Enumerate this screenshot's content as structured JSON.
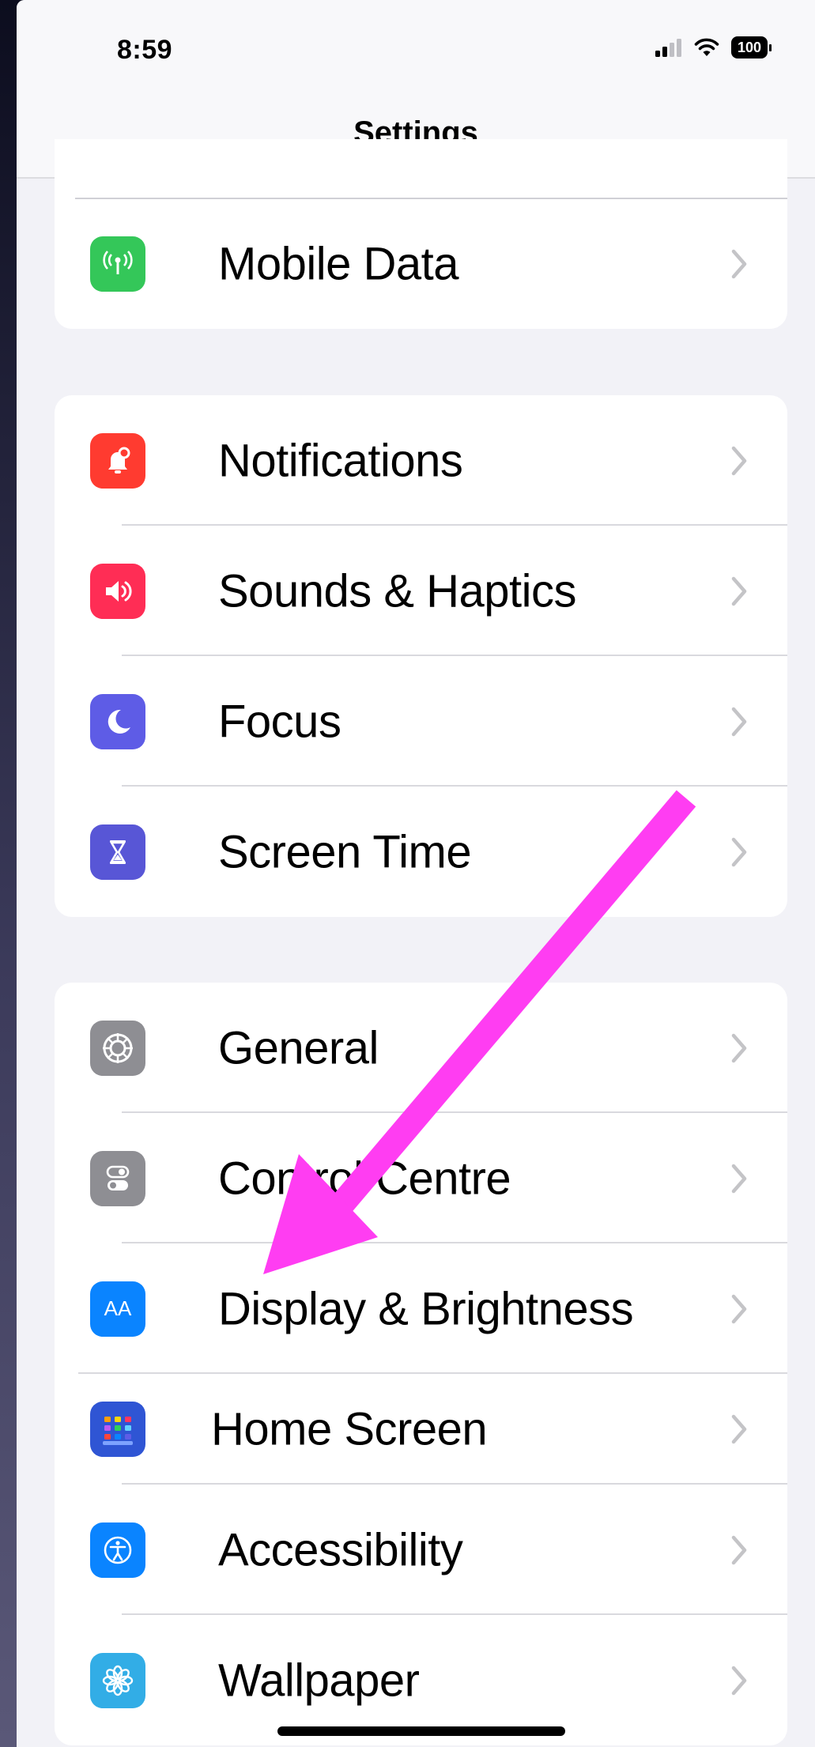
{
  "status_bar": {
    "time": "8:59",
    "battery": "100"
  },
  "nav": {
    "title": "Settings"
  },
  "groups": [
    {
      "items": [
        {
          "label": "Mobile Data",
          "icon": "antenna-icon",
          "color": "#34c759"
        }
      ]
    },
    {
      "items": [
        {
          "label": "Notifications",
          "icon": "notification-bell-icon",
          "color": "#ff3b30"
        },
        {
          "label": "Sounds & Haptics",
          "icon": "speaker-icon",
          "color": "#ff2d55"
        },
        {
          "label": "Focus",
          "icon": "moon-icon",
          "color": "#5e5ce6"
        },
        {
          "label": "Screen Time",
          "icon": "hourglass-icon",
          "color": "#5856d6"
        }
      ]
    },
    {
      "items": [
        {
          "label": "General",
          "icon": "gear-icon",
          "color": "#8e8e93"
        },
        {
          "label": "Control Centre",
          "icon": "toggles-icon",
          "color": "#8e8e93"
        },
        {
          "label": "Display & Brightness",
          "icon": "text-size-icon",
          "color": "#0a84ff"
        },
        {
          "label": "Home Screen",
          "icon": "app-grid-icon",
          "color": "#2f55d4"
        },
        {
          "label": "Accessibility",
          "icon": "accessibility-icon",
          "color": "#0a84ff"
        },
        {
          "label": "Wallpaper",
          "icon": "flower-icon",
          "color": "#32ade6"
        }
      ]
    }
  ],
  "display_icon_text": "AA",
  "annotation": {
    "arrow_color": "#ff3df2"
  }
}
